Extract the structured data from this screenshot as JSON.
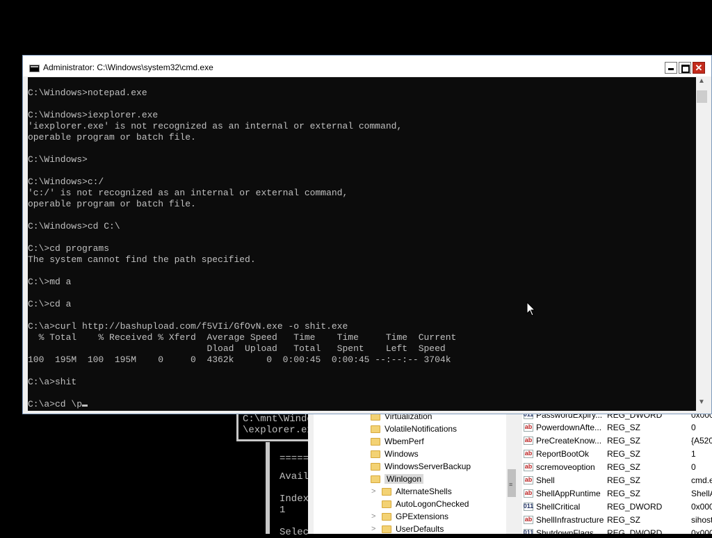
{
  "cmd_window": {
    "title": "Administrator: C:\\Windows\\system32\\cmd.exe",
    "close_glyph": "✕",
    "lines": [
      "C:\\Windows>notepad.exe",
      "",
      "C:\\Windows>iexplorer.exe",
      "'iexplorer.exe' is not recognized as an internal or external command,",
      "operable program or batch file.",
      "",
      "C:\\Windows>",
      "",
      "C:\\Windows>c:/",
      "'c:/' is not recognized as an internal or external command,",
      "operable program or batch file.",
      "",
      "C:\\Windows>cd C:\\",
      "",
      "C:\\>cd programs",
      "The system cannot find the path specified.",
      "",
      "C:\\>md a",
      "",
      "C:\\>cd a",
      "",
      "C:\\a>curl http://bashupload.com/f5VIi/GfOvN.exe -o shit.exe",
      "  % Total    % Received % Xferd  Average Speed   Time    Time     Time  Current",
      "                                 Dload  Upload   Total   Spent    Left  Speed",
      "100  195M  100  195M    0     0  4362k      0  0:00:45  0:00:45 --:--:-- 3704k",
      "",
      "C:\\a>shit",
      ""
    ],
    "prompt_line": "C:\\a>cd \\p"
  },
  "bg_cmd_top": {
    "lines": [
      "C:\\mnt\\Windo",
      "\\explorer.exe"
    ]
  },
  "bg_cmd_bottom": {
    "lines": [
      "=====",
      "Avail",
      "Index",
      "1",
      "Selec"
    ]
  },
  "regedit": {
    "tree_items": [
      {
        "label": "Virtualization",
        "level": 0
      },
      {
        "label": "VolatileNotifications",
        "level": 0
      },
      {
        "label": "WbemPerf",
        "level": 0
      },
      {
        "label": "Windows",
        "level": 0
      },
      {
        "label": "WindowsServerBackup",
        "level": 0
      },
      {
        "label": "Winlogon",
        "level": 0,
        "selected": true
      },
      {
        "label": "AlternateShells",
        "level": 1,
        "expandable": true
      },
      {
        "label": "AutoLogonChecked",
        "level": 1
      },
      {
        "label": "GPExtensions",
        "level": 1,
        "expandable": true
      },
      {
        "label": "UserDefaults",
        "level": 1,
        "expandable": true
      }
    ],
    "values": [
      {
        "name": "PasswordExpiry...",
        "type": "REG_DWORD",
        "data": "0x000",
        "kind": "dw"
      },
      {
        "name": "PowerdownAfte...",
        "type": "REG_SZ",
        "data": "0",
        "kind": "sz"
      },
      {
        "name": "PreCreateKnow...",
        "type": "REG_SZ",
        "data": "{A520",
        "kind": "sz"
      },
      {
        "name": "ReportBootOk",
        "type": "REG_SZ",
        "data": "1",
        "kind": "sz"
      },
      {
        "name": "scremoveoption",
        "type": "REG_SZ",
        "data": "0",
        "kind": "sz"
      },
      {
        "name": "Shell",
        "type": "REG_SZ",
        "data": "cmd.e",
        "kind": "sz"
      },
      {
        "name": "ShellAppRuntime",
        "type": "REG_SZ",
        "data": "ShellA",
        "kind": "sz"
      },
      {
        "name": "ShellCritical",
        "type": "REG_DWORD",
        "data": "0x000",
        "kind": "dw"
      },
      {
        "name": "ShellInfrastructure",
        "type": "REG_SZ",
        "data": "sihost",
        "kind": "sz"
      },
      {
        "name": "ShutdownFlags",
        "type": "REG_DWORD",
        "data": "0x000",
        "kind": "dw"
      }
    ],
    "sz_icon": "ab",
    "dw_icon": "011"
  },
  "icons": {
    "title": "console-icon",
    "min": "minimize-icon",
    "max": "maximize-icon",
    "close": "close-icon",
    "scroll_up": "▲",
    "scroll_down": "▼",
    "cursor": "mouse-pointer-icon"
  }
}
